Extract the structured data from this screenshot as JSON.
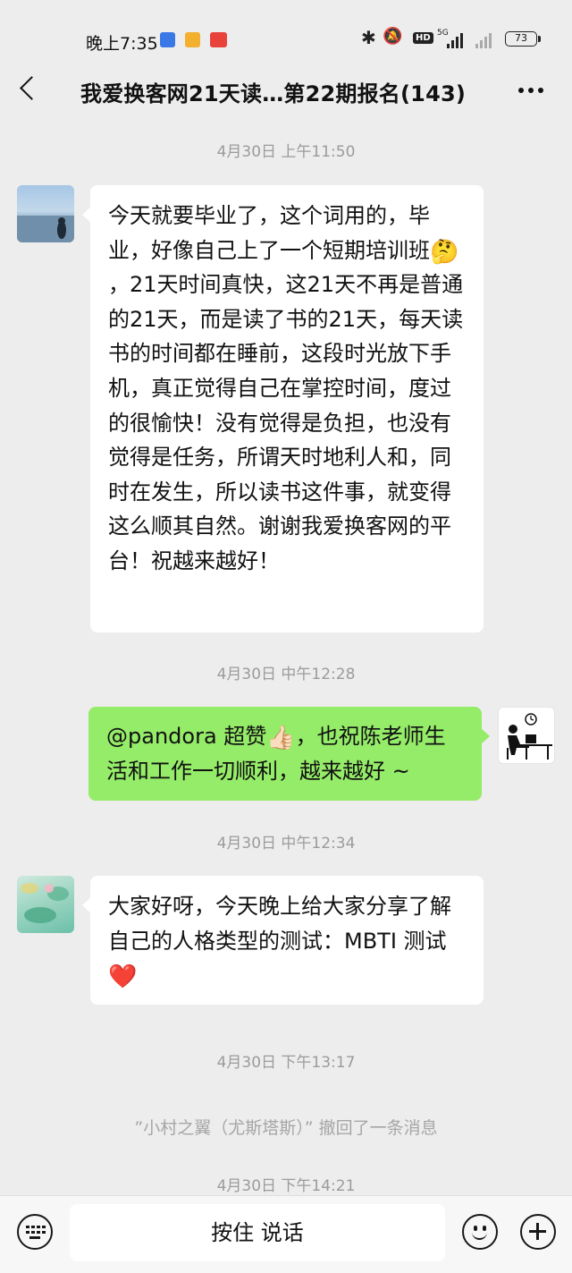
{
  "status_bar": {
    "time": "晚上7:35",
    "app3_label": "小红书",
    "hd": "HD",
    "network": "5G",
    "battery": "73"
  },
  "header": {
    "title": "我爱换客网21天读…第22期报名(143)"
  },
  "messages": {
    "ts1": "4月30日 上午11:50",
    "msg1": {
      "part1": "今天就要毕业了，这个词用的，毕业，好像自己上了一个短期培训班",
      "emoji": "🤔",
      "part2": "，21天时间真快，这21天不再是普通的21天，而是读了书的21天，每天读书的时间都在睡前，这段时光放下手机，真正觉得自己在掌控时间，度过的很愉快！没有觉得是负担，也没有觉得是任务，所谓天时地利人和，同时在发生，所以读书这件事，就变得这么顺其自然。谢谢我爱换客网的平台！祝越来越好！"
    },
    "ts2": "4月30日 中午12:28",
    "msg2": {
      "part1": "@pandora 超赞",
      "emoji": "👍🏻",
      "part2": "，也祝陈老师生活和工作一切顺利，越来越好 ~"
    },
    "ts3": "4月30日 中午12:34",
    "msg3": {
      "part1": "大家好呀，今天晚上给大家分享了解自己的人格类型的测试：MBTI 测试",
      "emoji": "❤️"
    },
    "ts4": "4月30日 下午13:17",
    "recall": "”小村之翼（尤斯塔斯）” 撤回了一条消息",
    "ts5": "4月30日 下午14:21"
  },
  "bottom_bar": {
    "voice_label": "按住 说话"
  },
  "colors": {
    "background": "#ededed",
    "incoming_bubble": "#ffffff",
    "outgoing_bubble": "#95ec69",
    "timestamp": "#9b9b9b"
  },
  "icons": [
    "back-arrow-icon",
    "more-icon",
    "keyboard-icon",
    "emoji-icon",
    "plus-icon",
    "bluetooth-icon",
    "mute-icon",
    "battery-icon"
  ]
}
